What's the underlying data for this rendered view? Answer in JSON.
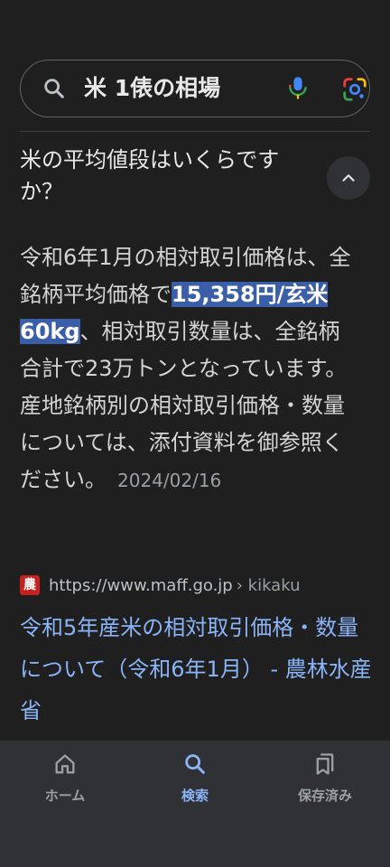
{
  "search": {
    "query": "米 1俵の相場"
  },
  "question": {
    "text": "米の平均値段はいくらですか？"
  },
  "answer": {
    "before": "令和6年1月の相対取引価格は、全銘柄平均価格で",
    "highlight": "15,358円/玄米60kg",
    "after": "、相対取引数量は、全銘柄合計で23万トンとなっています。 産地銘柄別の相対取引価格・数量については、添付資料を御参照ください。",
    "date": "2024/02/16"
  },
  "source": {
    "favicon_text": "農",
    "url": "https://www.maff.go.jp",
    "path": "› kikaku",
    "title": "令和5年産米の相対取引価格・数量について（令和6年1月） - 農林水産省"
  },
  "nav": {
    "items": [
      {
        "label": "ホーム",
        "icon": "home-icon"
      },
      {
        "label": "検索",
        "icon": "search-icon"
      },
      {
        "label": "保存済み",
        "icon": "saved-icon"
      }
    ],
    "active_index": 1
  },
  "colors": {
    "background": "#1f1f1f",
    "link": "#8ab4f8",
    "highlight": "#3b5ea8",
    "nav_bg": "#303134"
  }
}
